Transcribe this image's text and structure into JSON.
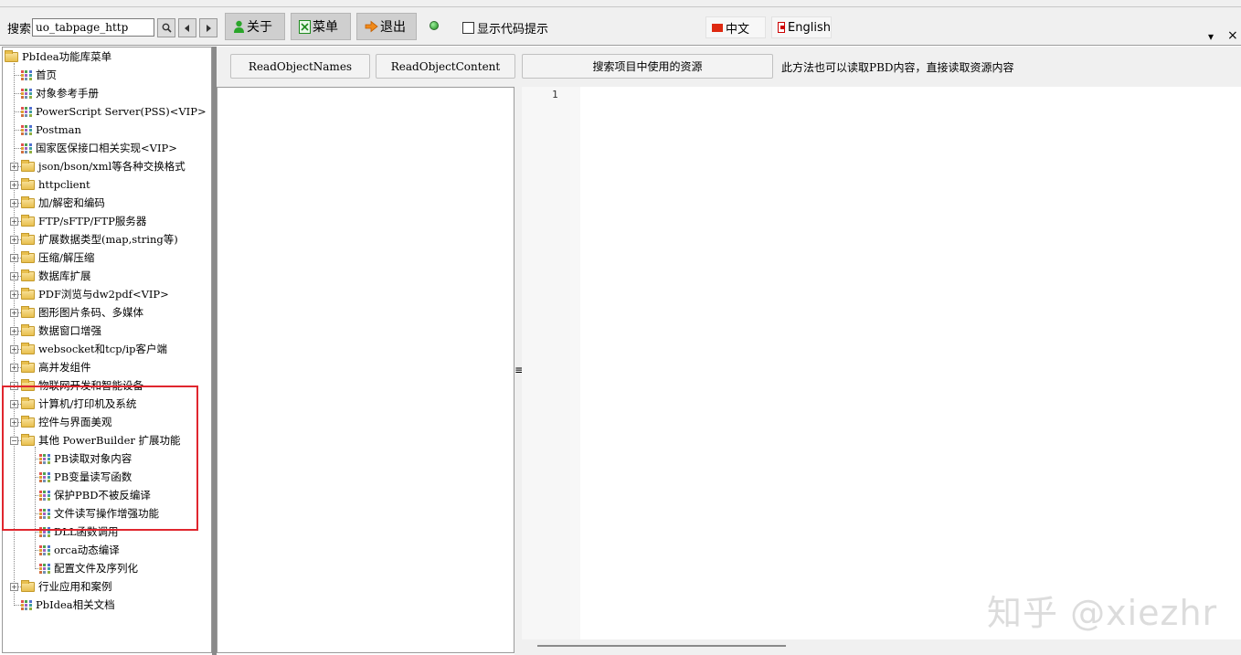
{
  "toolbar": {
    "search_label": "搜索",
    "search_value": "uo_tabpage_http",
    "about_label": "关于",
    "menu_label": "菜单",
    "exit_label": "退出",
    "show_code_hint_label": "显示代码提示",
    "lang_cn": "中文",
    "lang_en": "English",
    "dropdown_glyph": "▾",
    "close_glyph": "×"
  },
  "tree": {
    "root": "PbIdea功能库菜单",
    "items": [
      {
        "label": "首页",
        "type": "leaf"
      },
      {
        "label": "对象参考手册",
        "type": "leaf"
      },
      {
        "label": "PowerScript Server(PSS)<VIP>",
        "type": "leaf"
      },
      {
        "label": "Postman",
        "type": "leaf"
      },
      {
        "label": "国家医保接口相关实现<VIP>",
        "type": "leaf"
      },
      {
        "label": "json/bson/xml等各种交换格式",
        "type": "folder"
      },
      {
        "label": "httpclient",
        "type": "folder"
      },
      {
        "label": "加/解密和编码",
        "type": "folder"
      },
      {
        "label": "FTP/sFTP/FTP服务器",
        "type": "folder"
      },
      {
        "label": "扩展数据类型(map,string等)",
        "type": "folder"
      },
      {
        "label": "压缩/解压缩",
        "type": "folder"
      },
      {
        "label": "数据库扩展",
        "type": "folder"
      },
      {
        "label": "PDF浏览与dw2pdf<VIP>",
        "type": "folder"
      },
      {
        "label": "图形图片条码、多媒体",
        "type": "folder"
      },
      {
        "label": "数据窗口增强",
        "type": "folder"
      },
      {
        "label": "websocket和tcp/ip客户端",
        "type": "folder"
      },
      {
        "label": "高并发组件",
        "type": "folder"
      },
      {
        "label": "物联网开发和智能设备",
        "type": "folder"
      },
      {
        "label": "计算机/打印机及系统",
        "type": "folder"
      },
      {
        "label": "控件与界面美观",
        "type": "folder"
      },
      {
        "label": "其他 PowerBuilder 扩展功能",
        "type": "folder-open"
      },
      {
        "label": "PB读取对象内容",
        "type": "child"
      },
      {
        "label": "PB变量读写函数",
        "type": "child"
      },
      {
        "label": "保护PBD不被反编译",
        "type": "child"
      },
      {
        "label": "文件读写操作增强功能",
        "type": "child"
      },
      {
        "label": "DLL函数调用",
        "type": "child"
      },
      {
        "label": "orca动态编译",
        "type": "child"
      },
      {
        "label": "配置文件及序列化",
        "type": "child"
      },
      {
        "label": "行业应用和案例",
        "type": "folder"
      },
      {
        "label": "PbIdea相关文档",
        "type": "leaf"
      }
    ]
  },
  "actions": {
    "read_names": "ReadObjectNames",
    "read_content": "ReadObjectContent",
    "search_resources": "搜索项目中使用的资源",
    "note": "此方法也可以读取PBD内容，直接读取资源内容"
  },
  "editor": {
    "line_number": "1"
  },
  "splitter_glyph": "≡",
  "watermark": "知乎 @xiezhr"
}
